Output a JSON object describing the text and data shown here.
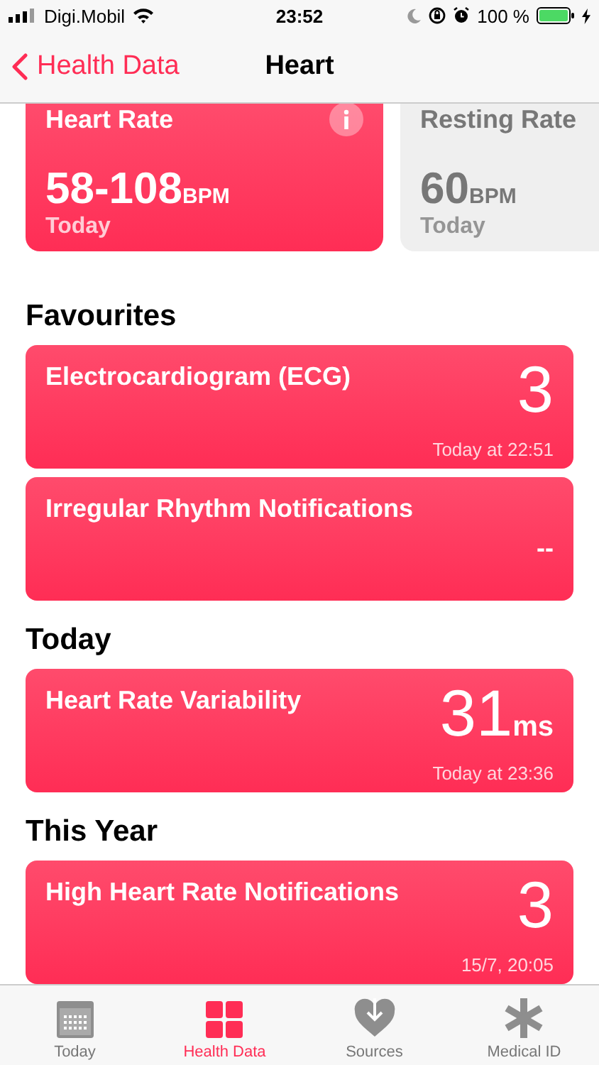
{
  "status_bar": {
    "carrier": "Digi.Mobil",
    "time": "23:52",
    "battery": "100 %"
  },
  "nav": {
    "back": "Health Data",
    "title": "Heart"
  },
  "summary_cards": [
    {
      "kind": "highlight",
      "title": "Heart Rate",
      "info": true,
      "value": "58-108",
      "unit": "BPM",
      "caption": "Today"
    },
    {
      "kind": "plain",
      "title": "Resting Rate",
      "info": false,
      "value": "60",
      "unit": "BPM",
      "caption": "Today"
    }
  ],
  "sections": [
    {
      "title": "Favourites",
      "items": [
        {
          "title": "Electrocardiogram (ECG)",
          "value": "3",
          "caption": "Today at 22:51"
        },
        {
          "title": "Irregular Rhythm Notifications",
          "value": "--"
        }
      ]
    },
    {
      "title": "Today",
      "items": [
        {
          "title": "Heart Rate Variability",
          "value": "31",
          "unit": "ms",
          "caption": "Today at 23:36"
        }
      ]
    },
    {
      "title": "This Year",
      "items": [
        {
          "title": "High Heart Rate Notifications",
          "value": "3",
          "caption": "15/7, 20:05"
        }
      ]
    }
  ],
  "tabs": [
    {
      "kind": "calendar",
      "label": "Today",
      "selected": false
    },
    {
      "kind": "grid",
      "label": "Health Data",
      "selected": true
    },
    {
      "kind": "heart",
      "label": "Sources",
      "selected": false
    },
    {
      "kind": "asterisk",
      "label": "Medical ID",
      "selected": false
    }
  ]
}
